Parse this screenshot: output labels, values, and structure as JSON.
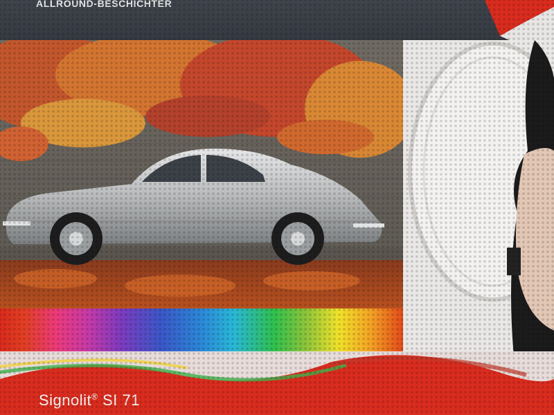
{
  "header": {
    "brand_text": "ALLROUND-BESCHICHTER"
  },
  "footer": {
    "product_name": "Signolit",
    "product_reg": "®",
    "product_model": " SI 71"
  },
  "colors": {
    "header_bg": "#3a3f47",
    "accent_red": "#d92c1e",
    "silver_car": "#b9bbbc",
    "foliage_orange": "#e36a2a"
  }
}
